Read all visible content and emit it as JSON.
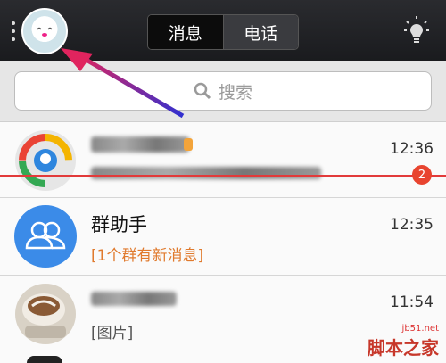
{
  "header": {
    "tab_messages": "消息",
    "tab_calls": "电话"
  },
  "search": {
    "placeholder": "搜索"
  },
  "conversations": [
    {
      "time": "12:36",
      "badge": "2"
    },
    {
      "name": "群助手",
      "preview": "[1个群有新消息]",
      "time": "12:35"
    },
    {
      "preview": "[图片]",
      "time": "11:54"
    }
  ],
  "watermark": {
    "site": "jb51.net",
    "brand": "脚本之家"
  },
  "colors": {
    "accent_blue": "#3b8be8",
    "highlight_orange": "#e07a2d",
    "badge_red": "#e8442f",
    "arrow": "#e0245e"
  },
  "icons": [
    "menu-dots-icon",
    "lightbulb-icon",
    "search-icon",
    "qq-browser-icon",
    "group-assistant-icon"
  ]
}
